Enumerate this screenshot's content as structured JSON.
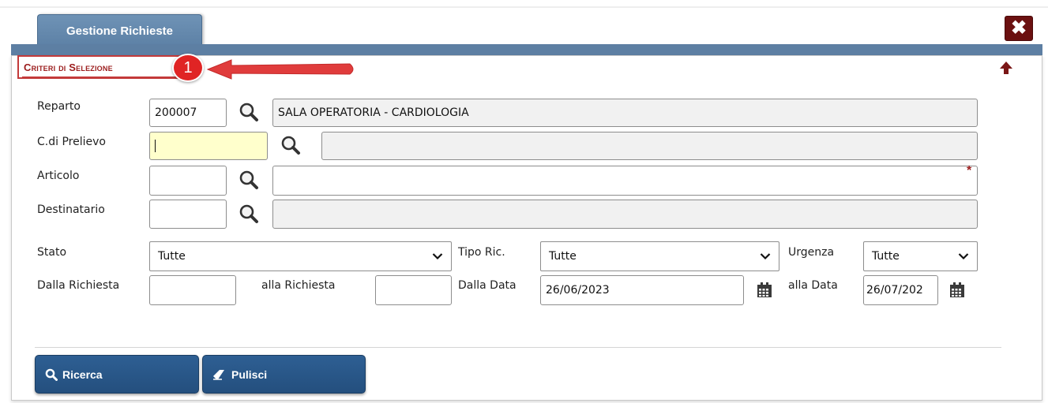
{
  "tab": {
    "label": "Gestione Richieste"
  },
  "close_label": "✖",
  "section": {
    "title": "Criteri di Selezione",
    "badge": "1"
  },
  "fields": {
    "reparto": {
      "label": "Reparto",
      "code": "200007",
      "description": "SALA OPERATORIA - CARDIOLOGIA"
    },
    "prelievo": {
      "label": "C.di Prelievo",
      "code": "",
      "description": ""
    },
    "articolo": {
      "label": "Articolo",
      "code": "",
      "description": "",
      "required_mark": "*"
    },
    "destinatario": {
      "label": "Destinatario",
      "code": "",
      "description": ""
    }
  },
  "filters": {
    "stato": {
      "label": "Stato",
      "value": "Tutte"
    },
    "tipo_ric": {
      "label": "Tipo Ric.",
      "value": "Tutte"
    },
    "urgenza": {
      "label": "Urgenza",
      "value": "Tutte"
    },
    "dalla_richiesta": {
      "label": "Dalla Richiesta",
      "value": ""
    },
    "alla_richiesta": {
      "label": "alla Richiesta",
      "value": ""
    },
    "dalla_data": {
      "label": "Dalla Data",
      "value": "26/06/2023"
    },
    "alla_data": {
      "label": "alla Data",
      "value": "26/07/202"
    }
  },
  "buttons": {
    "ricerca": "Ricerca",
    "pulisci": "Pulisci"
  },
  "colors": {
    "header": "#5d7fa3",
    "accent_red": "#c33a3a",
    "button": "#2a5788",
    "required": "#9b1c1c"
  },
  "icons": [
    "close-icon",
    "up-arrow-icon",
    "magnifier-icon",
    "calendar-icon",
    "chevron-down-icon",
    "search-icon",
    "eraser-icon"
  ]
}
